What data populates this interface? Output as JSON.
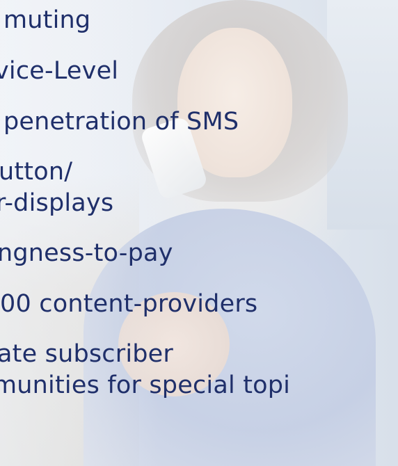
{
  "lines": [
    "muting",
    "vice-Level",
    "penetration of SMS",
    "utton/",
    "r-displays",
    "ngness-to-pay",
    "00 content-providers",
    "ate subscriber",
    "munities for special topi"
  ]
}
